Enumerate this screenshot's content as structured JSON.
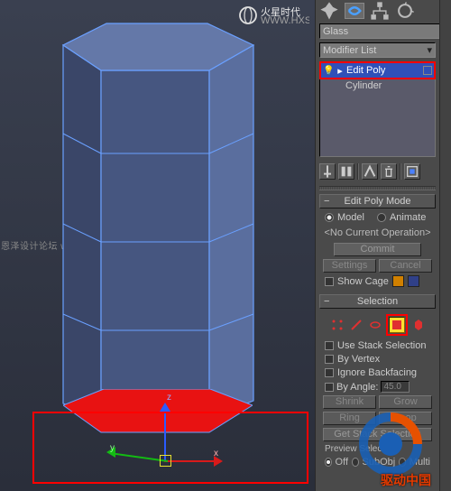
{
  "viewport": {
    "watermark_top": "火星时代",
    "watermark_top_sub": "WWW.HXSD.CN",
    "watermark_mid": "恩泽设计论坛 www.missyuan.com",
    "axis_x": "x",
    "axis_y": "y",
    "axis_z": "z"
  },
  "panel": {
    "object_name": "Glass",
    "modifier_dropdown": "Modifier List",
    "stack": [
      {
        "label": "Edit Poly",
        "selected": true,
        "expandable": true
      },
      {
        "label": "Cylinder",
        "selected": false,
        "expandable": false
      }
    ]
  },
  "edit_poly": {
    "title": "Edit Poly Mode",
    "model": "Model",
    "animate": "Animate",
    "noop": "<No Current Operation>",
    "commit": "Commit",
    "settings": "Settings",
    "cancel": "Cancel",
    "show_cage": "Show Cage",
    "cage_color1": "#d08000",
    "cage_color2": "#304088"
  },
  "selection": {
    "title": "Selection",
    "use_stack": "Use Stack Selection",
    "by_vertex": "By Vertex",
    "ignore_backfacing": "Ignore Backfacing",
    "by_angle": "By Angle:",
    "by_angle_value": "45.0",
    "shrink": "Shrink",
    "grow": "Grow",
    "ring": "Ring",
    "loop": "Loop",
    "get_stack": "Get Stack Selection",
    "preview": "Preview Selection",
    "off": "Off",
    "subobj": "SubObj",
    "multi": "Multi"
  },
  "wm_big": "驱动中国"
}
